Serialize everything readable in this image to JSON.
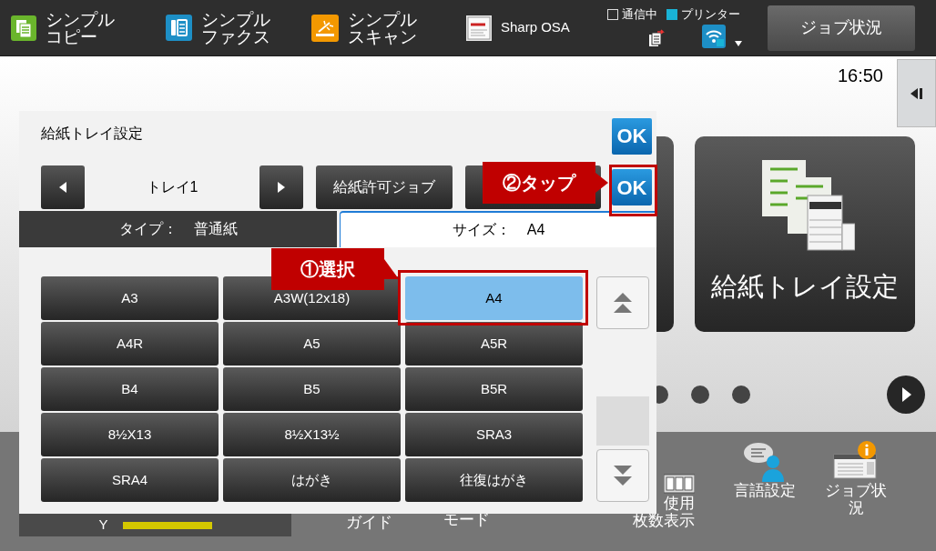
{
  "top_bar": {
    "apps": [
      {
        "kind": "copy",
        "lines": [
          "シンプル",
          "コピー"
        ]
      },
      {
        "kind": "fax",
        "lines": [
          "シンプル",
          "ファクス"
        ]
      },
      {
        "kind": "scan",
        "lines": [
          "シンプル",
          "スキャン"
        ]
      },
      {
        "kind": "osa",
        "lines": [
          "Sharp OSA"
        ]
      }
    ],
    "indicators": [
      {
        "label": "通信中",
        "on": false
      },
      {
        "label": "プリンター",
        "on": true
      }
    ],
    "job_status_button": "ジョブ状況"
  },
  "clock": "16:50",
  "home_card": {
    "title": "給紙トレイ設定"
  },
  "toner": {
    "label": "Y",
    "level": 1
  },
  "bottom_shortcuts": [
    {
      "kind": "guide",
      "lines": [
        "ガイド"
      ]
    },
    {
      "kind": "mode",
      "lines": [
        "モード"
      ]
    },
    {
      "kind": "counter",
      "lines": [
        "使用",
        "枚数表示"
      ]
    },
    {
      "kind": "language",
      "lines": [
        "言語設定"
      ]
    },
    {
      "kind": "job",
      "lines": [
        "ジョブ状",
        "況"
      ]
    }
  ],
  "dialog": {
    "title": "給紙トレイ設定",
    "ok": "OK",
    "tray": "トレイ1",
    "job_button": "給紙許可ジョブ",
    "ok_2": "OK",
    "tabs": [
      {
        "label": "タイプ：",
        "value": "普通紙",
        "selected": false
      },
      {
        "label": "サイズ：",
        "value": "A4",
        "selected": true
      }
    ],
    "sizes": [
      {
        "label": "A3",
        "selected": false
      },
      {
        "label": "A3W(12x18)",
        "selected": false
      },
      {
        "label": "A4",
        "selected": true
      },
      {
        "label": "A4R",
        "selected": false
      },
      {
        "label": "A5",
        "selected": false
      },
      {
        "label": "A5R",
        "selected": false
      },
      {
        "label": "B4",
        "selected": false
      },
      {
        "label": "B5",
        "selected": false
      },
      {
        "label": "B5R",
        "selected": false
      },
      {
        "label": "8½X13",
        "selected": false
      },
      {
        "label": "8½X13½",
        "selected": false
      },
      {
        "label": "SRA3",
        "selected": false
      },
      {
        "label": "SRA4",
        "selected": false
      },
      {
        "label": "はがき",
        "selected": false
      },
      {
        "label": "往復はがき",
        "selected": false
      }
    ]
  },
  "callouts": [
    {
      "label": "①選択"
    },
    {
      "label": "②タップ"
    }
  ]
}
